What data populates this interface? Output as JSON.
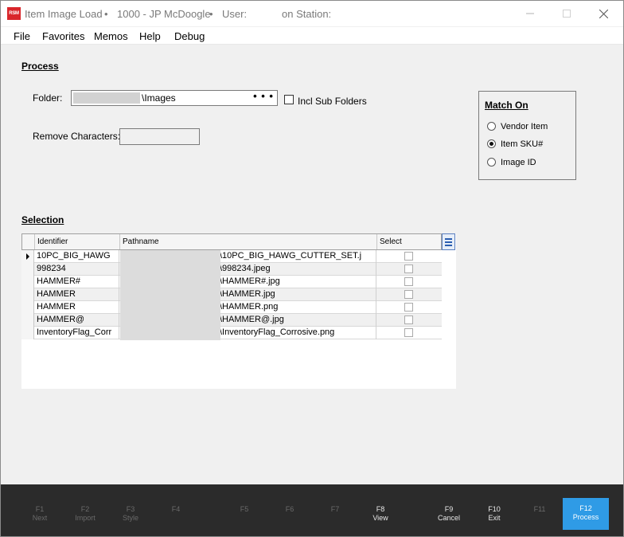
{
  "titlebar": {
    "logo": "RSM",
    "app_title": "Item Image Load",
    "separator": "•",
    "company": "1000 - JP McDoogle",
    "user_label": "User:",
    "station_label": "on Station:"
  },
  "menu": {
    "items": [
      "File",
      "Favorites",
      "Memos",
      "Help",
      "Debug"
    ]
  },
  "process": {
    "title": "Process",
    "folder_label": "Folder:",
    "folder_value": "\\Images",
    "folder_browse": "• • •",
    "incl_sub_label": "Incl Sub Folders",
    "remove_chars_label": "Remove Characters:",
    "remove_chars_value": ""
  },
  "match_on": {
    "title": "Match On",
    "options": [
      {
        "label": "Vendor Item",
        "selected": false
      },
      {
        "label": "Item SKU#",
        "selected": true
      },
      {
        "label": "Image ID",
        "selected": false
      }
    ]
  },
  "selection": {
    "title": "Selection",
    "columns": [
      "Identifier",
      "Pathname",
      "Select"
    ],
    "rows": [
      {
        "identifier": "10PC_BIG_HAWG",
        "path": "\\10PC_BIG_HAWG_CUTTER_SET.j",
        "current": true
      },
      {
        "identifier": "998234",
        "path": "\\998234.jpeg",
        "current": false
      },
      {
        "identifier": "HAMMER#",
        "path": "\\HAMMER#.jpg",
        "current": false
      },
      {
        "identifier": "HAMMER",
        "path": "\\HAMMER.jpg",
        "current": false
      },
      {
        "identifier": "HAMMER",
        "path": "\\HAMMER.png",
        "current": false
      },
      {
        "identifier": "HAMMER@",
        "path": "\\HAMMER@.jpg",
        "current": false
      },
      {
        "identifier": "InventoryFlag_Corr",
        "path": "\\InventoryFlag_Corrosive.png",
        "current": false
      }
    ]
  },
  "fkeys": [
    {
      "key": "F1",
      "label": "Next",
      "state": "disabled"
    },
    {
      "key": "F2",
      "label": "Import",
      "state": "disabled"
    },
    {
      "key": "F3",
      "label": "Style",
      "state": "disabled"
    },
    {
      "key": "F4",
      "label": "",
      "state": "disabled"
    },
    {
      "key": "F5",
      "label": "",
      "state": "disabled"
    },
    {
      "key": "F6",
      "label": "",
      "state": "disabled"
    },
    {
      "key": "F7",
      "label": "",
      "state": "disabled"
    },
    {
      "key": "F8",
      "label": "View",
      "state": "enabled"
    },
    {
      "key": "F9",
      "label": "Cancel",
      "state": "enabled"
    },
    {
      "key": "F10",
      "label": "Exit",
      "state": "enabled"
    },
    {
      "key": "F11",
      "label": "",
      "state": "disabled"
    },
    {
      "key": "F12",
      "label": "Process",
      "state": "active"
    }
  ]
}
